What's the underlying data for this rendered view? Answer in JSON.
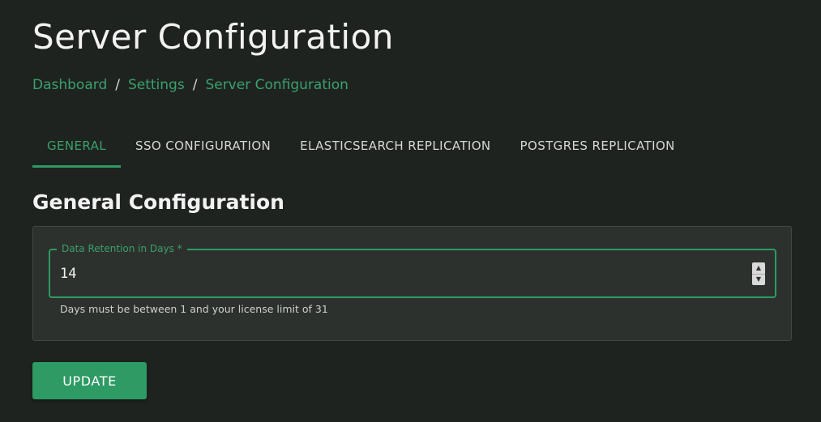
{
  "page": {
    "title": "Server Configuration"
  },
  "breadcrumb": {
    "items": [
      "Dashboard",
      "Settings",
      "Server Configuration"
    ],
    "separator": "/"
  },
  "tabs": [
    {
      "label": "GENERAL",
      "active": true
    },
    {
      "label": "SSO CONFIGURATION",
      "active": false
    },
    {
      "label": "ELASTICSEARCH REPLICATION",
      "active": false
    },
    {
      "label": "POSTGRES REPLICATION",
      "active": false
    }
  ],
  "section": {
    "title": "General Configuration"
  },
  "retention_field": {
    "label": "Data Retention in Days *",
    "value": "14",
    "helper": "Days must be between 1 and your license limit of 31",
    "stepper_up": "▲",
    "stepper_down": "▼"
  },
  "actions": {
    "update_label": "UPDATE"
  },
  "colors": {
    "background": "#1f231f",
    "accent": "#2e9a64",
    "link": "#3aa06e",
    "card": "#2d312d"
  }
}
